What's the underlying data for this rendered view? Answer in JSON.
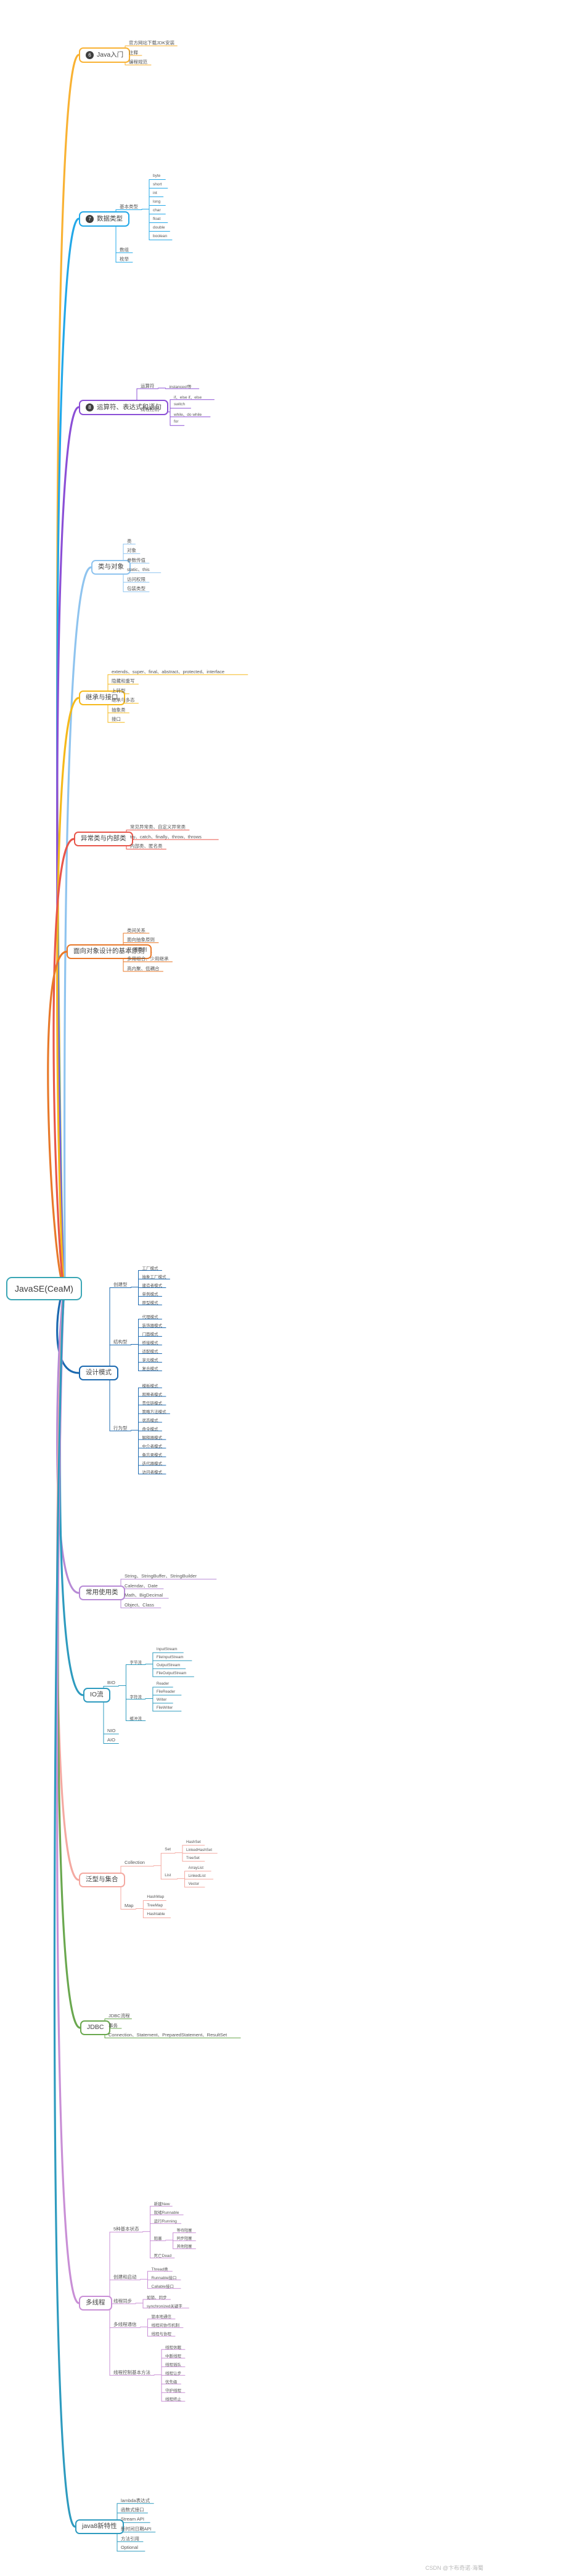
{
  "root": {
    "label": "JavaSE(CeaM)",
    "color": "#3aa6b5"
  },
  "watermark": "CSDN @卞布奇诺·海蜀",
  "branches": [
    {
      "id": "java-intro",
      "badge": "6",
      "label": "Java入门",
      "color": "#f9b233",
      "children": [
        {
          "label": "官方网站下载JDK安装"
        },
        {
          "label": "注释"
        },
        {
          "label": "编程规范"
        }
      ]
    },
    {
      "id": "data-types",
      "badge": "7",
      "label": "数据类型",
      "color": "#23a8e8",
      "children": [
        {
          "label": "基本类型",
          "children": [
            {
              "label": "byte"
            },
            {
              "label": "short"
            },
            {
              "label": "int"
            },
            {
              "label": "long"
            },
            {
              "label": "char"
            },
            {
              "label": "float"
            },
            {
              "label": "double"
            },
            {
              "label": "boolean"
            }
          ]
        },
        {
          "label": "数组"
        },
        {
          "label": "枚举"
        }
      ]
    },
    {
      "id": "operators",
      "badge": "8",
      "label": "运算符、表达式和语句",
      "color": "#8b4fd6",
      "children": [
        {
          "label": "运算符",
          "children": [
            {
              "label": "instanceof等"
            }
          ]
        },
        {
          "label": "流程控制",
          "children": [
            {
              "label": "if、else if、else"
            },
            {
              "label": "switch"
            },
            {
              "label": "while、do while"
            },
            {
              "label": "for"
            }
          ]
        }
      ]
    },
    {
      "id": "class-object",
      "badge": "",
      "label": "类与对象",
      "color": "#8fc4ef",
      "children": [
        {
          "label": "类"
        },
        {
          "label": "对象"
        },
        {
          "label": "参数传值"
        },
        {
          "label": "static、this"
        },
        {
          "label": "访问权限"
        },
        {
          "label": "包装类型"
        }
      ]
    },
    {
      "id": "inherit-interface",
      "badge": "",
      "label": "继承与接口",
      "color": "#f5b91b",
      "children": [
        {
          "label": "extends、super、final、abstract、protected、interface"
        },
        {
          "label": "隐藏和重写"
        },
        {
          "label": "上转型"
        },
        {
          "label": "继承与多态"
        },
        {
          "label": "抽象类"
        },
        {
          "label": "接口"
        }
      ]
    },
    {
      "id": "exception-inner",
      "badge": "",
      "label": "异常类与内部类",
      "color": "#e8564a",
      "children": [
        {
          "label": "常见异常类、自定义异常类"
        },
        {
          "label": "try、catch、finally、throw、throws"
        },
        {
          "label": "内部类、匿名类"
        }
      ]
    },
    {
      "id": "oo-principles",
      "badge": "",
      "label": "面向对象设计的基本原则",
      "color": "#e8792a",
      "children": [
        {
          "label": "类间关系"
        },
        {
          "label": "面向抽象原则"
        },
        {
          "label": "开-闭原则"
        },
        {
          "label": "多用组合、少用继承"
        },
        {
          "label": "高内聚、低耦合"
        }
      ]
    },
    {
      "id": "design-patterns",
      "badge": "",
      "label": "设计模式",
      "color": "#1b69b0",
      "children": [
        {
          "label": "创建型",
          "children": [
            {
              "label": "工厂模式"
            },
            {
              "label": "抽象工厂模式"
            },
            {
              "label": "建造者模式"
            },
            {
              "label": "单例模式"
            },
            {
              "label": "原型模式"
            }
          ]
        },
        {
          "label": "结构型",
          "children": [
            {
              "label": "代理模式"
            },
            {
              "label": "装饰器模式"
            },
            {
              "label": "门面模式"
            },
            {
              "label": "桥接模式"
            },
            {
              "label": "适配模式"
            },
            {
              "label": "享元模式"
            },
            {
              "label": "复合模式"
            }
          ]
        },
        {
          "label": "行为型",
          "children": [
            {
              "label": "模板模式"
            },
            {
              "label": "观察者模式"
            },
            {
              "label": "责任链模式"
            },
            {
              "label": "策略方法模式"
            },
            {
              "label": "状态模式"
            },
            {
              "label": "命令模式"
            },
            {
              "label": "解释器模式"
            },
            {
              "label": "中介者模式"
            },
            {
              "label": "备忘录模式"
            },
            {
              "label": "迭代器模式"
            },
            {
              "label": "访问者模式"
            }
          ]
        }
      ]
    },
    {
      "id": "common-classes",
      "badge": "",
      "label": "常用使用类",
      "color": "#b78ad6",
      "children": [
        {
          "label": "String、StringBuffer、StringBuilder"
        },
        {
          "label": "Calendar、Date"
        },
        {
          "label": "Math、BigDecimal"
        },
        {
          "label": "Object、Class"
        }
      ]
    },
    {
      "id": "io",
      "badge": "",
      "label": "IO流",
      "color": "#2e9bbf",
      "children": [
        {
          "label": "BIO",
          "children": [
            {
              "label": "字节流",
              "children": [
                {
                  "label": "InputStream"
                },
                {
                  "label": "FileInputStream"
                },
                {
                  "label": "OutputStream"
                },
                {
                  "label": "FileOutputStream"
                }
              ]
            },
            {
              "label": "字符流",
              "children": [
                {
                  "label": "Reader"
                },
                {
                  "label": "FileReader"
                },
                {
                  "label": "Writer"
                },
                {
                  "label": "FileWriter"
                }
              ]
            },
            {
              "label": "缓冲流"
            }
          ]
        },
        {
          "label": "NIO"
        },
        {
          "label": "AIO"
        }
      ]
    },
    {
      "id": "generics-collections",
      "badge": "",
      "label": "泛型与集合",
      "color": "#f4a9a1",
      "children": [
        {
          "label": "Collection",
          "children": [
            {
              "label": "Set",
              "children": [
                {
                  "label": "HashSet"
                },
                {
                  "label": "LinkedHashSet"
                },
                {
                  "label": "TreeSet"
                }
              ]
            },
            {
              "label": "List",
              "children": [
                {
                  "label": "ArrayList"
                },
                {
                  "label": "LinkedList"
                },
                {
                  "label": "Vector"
                }
              ]
            }
          ]
        },
        {
          "label": "Map",
          "children": [
            {
              "label": "HashMap"
            },
            {
              "label": "TreeMap"
            },
            {
              "label": "Hashtable"
            }
          ]
        }
      ]
    },
    {
      "id": "jdbc",
      "badge": "",
      "label": "JDBC",
      "color": "#6aa84f",
      "children": [
        {
          "label": "JDBC流程"
        },
        {
          "label": "事务"
        },
        {
          "label": "Connection、Statement、PreparedStatement、ResultSet"
        }
      ]
    },
    {
      "id": "multithread",
      "badge": "",
      "label": "多线程",
      "color": "#c98fd6",
      "children": [
        {
          "label": "5种基本状态",
          "children": [
            {
              "label": "新建New"
            },
            {
              "label": "就绪Runnable"
            },
            {
              "label": "运行Running"
            },
            {
              "label": "阻塞",
              "children": [
                {
                  "label": "等待阻塞"
                },
                {
                  "label": "同步阻塞"
                },
                {
                  "label": "其他阻塞"
                }
              ]
            },
            {
              "label": "死亡Dead"
            }
          ]
        },
        {
          "label": "创建和启动",
          "children": [
            {
              "label": "Thread类"
            },
            {
              "label": "Runnable接口"
            },
            {
              "label": "Callable接口"
            }
          ]
        },
        {
          "label": "线程同步",
          "children": [
            {
              "label": "如锁、同步"
            },
            {
              "label": "synchronized关键字"
            }
          ]
        },
        {
          "label": "多线程通信",
          "children": [
            {
              "label": "锁本地通信"
            },
            {
              "label": "线程间协作机制"
            },
            {
              "label": "线程与协程"
            }
          ]
        },
        {
          "label": "线程控制基本方法",
          "children": [
            {
              "label": "线程休眠"
            },
            {
              "label": "中断线程"
            },
            {
              "label": "线程插队"
            },
            {
              "label": "线程让步"
            },
            {
              "label": "优先级"
            },
            {
              "label": "守护线程"
            },
            {
              "label": "线程终止"
            }
          ]
        }
      ]
    },
    {
      "id": "java8",
      "badge": "",
      "label": "java8新特性",
      "color": "#2e9bbf",
      "children": [
        {
          "label": "lambda表达式"
        },
        {
          "label": "函数式接口"
        },
        {
          "label": "Stream API"
        },
        {
          "label": "新时间日期API"
        },
        {
          "label": "方法引用"
        },
        {
          "label": "Optional"
        }
      ]
    }
  ]
}
